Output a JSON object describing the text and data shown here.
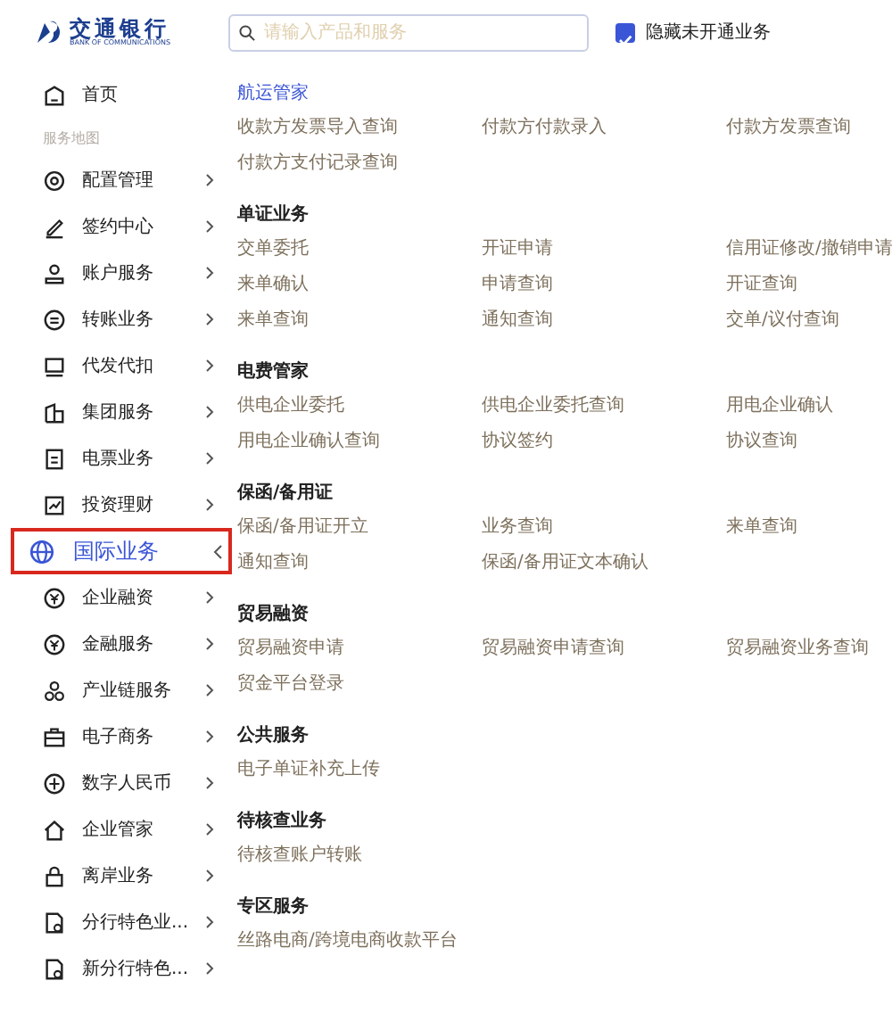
{
  "header": {
    "logo": {
      "name": "交通银行",
      "subtitle": "BANK OF COMMUNICATIONS"
    },
    "search": {
      "placeholder": "请输入产品和服务"
    },
    "hide_unopened": {
      "label": "隐藏未开通业务",
      "checked": true
    }
  },
  "sidebar": {
    "home": "首页",
    "section_label": "服务地图",
    "items": [
      {
        "label": "配置管理",
        "selected": false
      },
      {
        "label": "签约中心",
        "selected": false
      },
      {
        "label": "账户服务",
        "selected": false
      },
      {
        "label": "转账业务",
        "selected": false
      },
      {
        "label": "代发代扣",
        "selected": false
      },
      {
        "label": "集团服务",
        "selected": false
      },
      {
        "label": "电票业务",
        "selected": false
      },
      {
        "label": "投资理财",
        "selected": false
      },
      {
        "label": "国际业务",
        "selected": true
      },
      {
        "label": "企业融资",
        "selected": false
      },
      {
        "label": "金融服务",
        "selected": false
      },
      {
        "label": "产业链服务",
        "selected": false
      },
      {
        "label": "电子商务",
        "selected": false
      },
      {
        "label": "数字人民币",
        "selected": false
      },
      {
        "label": "企业管家",
        "selected": false
      },
      {
        "label": "离岸业务",
        "selected": false
      },
      {
        "label": "分行特色业...",
        "selected": false
      },
      {
        "label": "新分行特色...",
        "selected": false
      }
    ]
  },
  "content": {
    "sections": [
      {
        "title": "航运管家",
        "highlighted": true,
        "links": [
          "收款方发票导入查询",
          "付款方付款录入",
          "付款方发票查询",
          "付款方支付记录查询"
        ]
      },
      {
        "title": "单证业务",
        "highlighted": false,
        "links": [
          "交单委托",
          "开证申请",
          "信用证修改/撤销申请",
          "来单确认",
          "申请查询",
          "开证查询",
          "来单查询",
          "通知查询",
          "交单/议付查询"
        ]
      },
      {
        "title": "电费管家",
        "highlighted": false,
        "links": [
          "供电企业委托",
          "供电企业委托查询",
          "用电企业确认",
          "用电企业确认查询",
          "协议签约",
          "协议查询"
        ]
      },
      {
        "title": "保函/备用证",
        "highlighted": false,
        "links": [
          "保函/备用证开立",
          "业务查询",
          "来单查询",
          "通知查询",
          "保函/备用证文本确认"
        ]
      },
      {
        "title": "贸易融资",
        "highlighted": false,
        "links": [
          "贸易融资申请",
          "贸易融资申请查询",
          "贸易融资业务查询",
          "贸金平台登录"
        ]
      },
      {
        "title": "公共服务",
        "highlighted": false,
        "links": [
          "电子单证补充上传"
        ]
      },
      {
        "title": "待核查业务",
        "highlighted": false,
        "links": [
          "待核查账户转账"
        ]
      },
      {
        "title": "专区服务",
        "highlighted": false,
        "links": [
          "丝路电商/跨境电商收款平台"
        ]
      }
    ]
  }
}
